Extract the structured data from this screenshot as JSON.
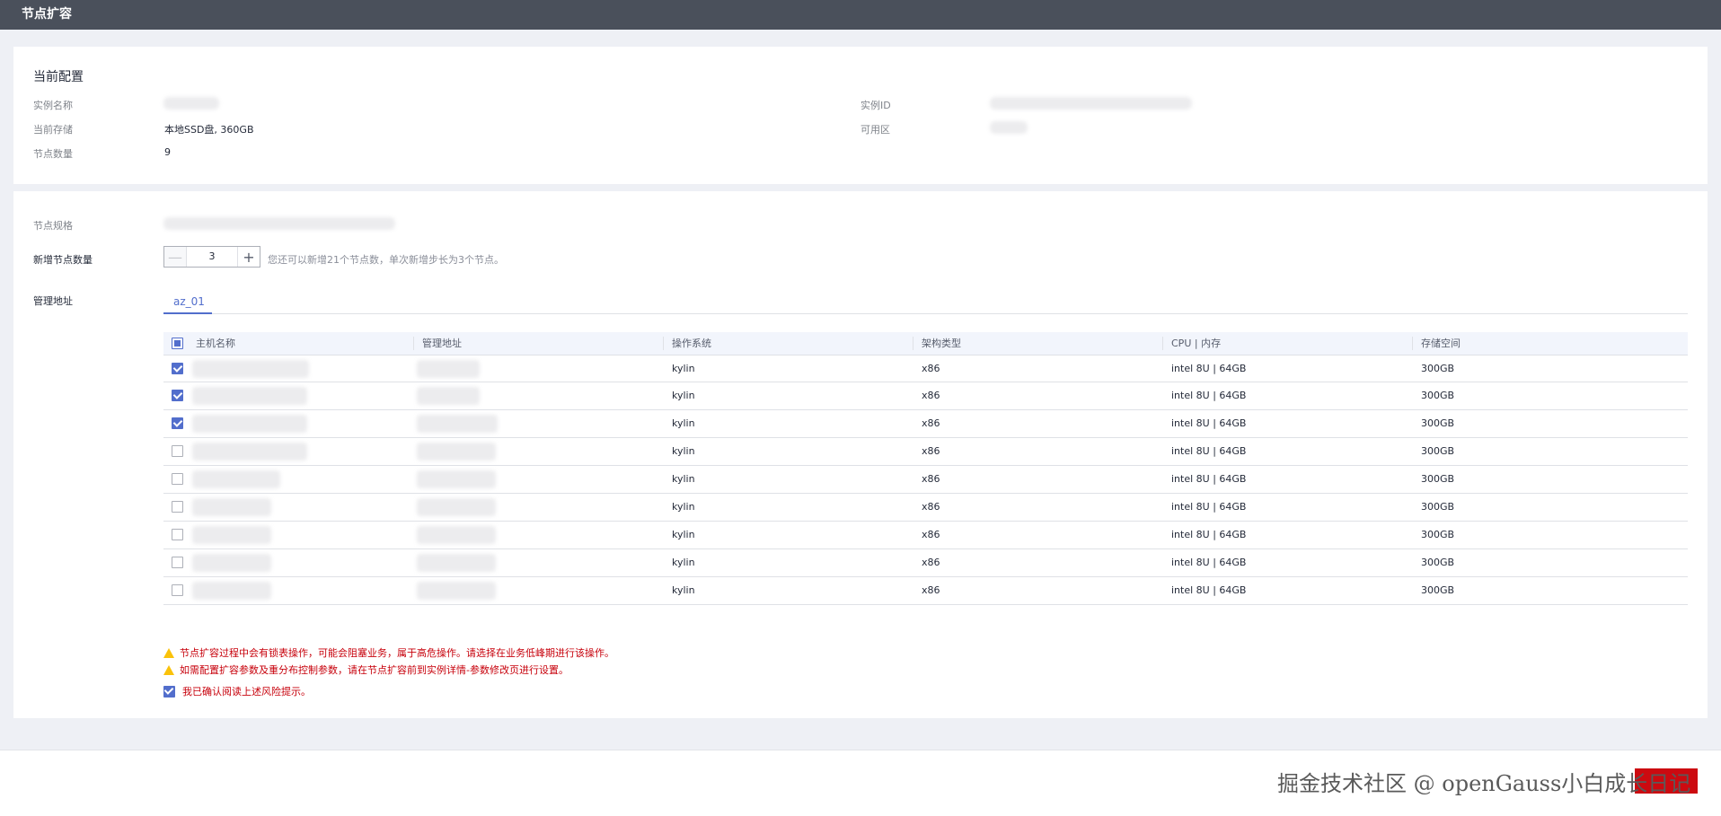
{
  "window": {
    "title": "节点扩容"
  },
  "current_config": {
    "section_title": "当前配置",
    "instance_name_label": "实例名称",
    "instance_id_label": "实例ID",
    "storage_label": "当前存储",
    "storage_value": "本地SSD盘, 360GB",
    "az_label": "可用区",
    "node_count_label": "节点数量",
    "node_count_value": "9"
  },
  "form": {
    "spec_label": "节点规格",
    "add_count_label": "新增节点数量",
    "add_count_value": "3",
    "add_count_hint": "您还可以新增21个节点数，单次新增步长为3个节点。",
    "mgmt_label": "管理地址"
  },
  "tabs": [
    {
      "label": "az_01",
      "active": true
    }
  ],
  "table": {
    "headers": [
      "主机名称",
      "管理地址",
      "操作系统",
      "架构类型",
      "CPU | 内存",
      "存储空间"
    ],
    "header_checkbox": "partial",
    "rows": [
      {
        "checked": true,
        "os": "kylin",
        "arch": "x86",
        "cpu_mem": "intel 8U | 64GB",
        "storage": "300GB"
      },
      {
        "checked": true,
        "os": "kylin",
        "arch": "x86",
        "cpu_mem": "intel 8U | 64GB",
        "storage": "300GB"
      },
      {
        "checked": true,
        "os": "kylin",
        "arch": "x86",
        "cpu_mem": "intel 8U | 64GB",
        "storage": "300GB"
      },
      {
        "checked": false,
        "os": "kylin",
        "arch": "x86",
        "cpu_mem": "intel 8U | 64GB",
        "storage": "300GB"
      },
      {
        "checked": false,
        "os": "kylin",
        "arch": "x86",
        "cpu_mem": "intel 8U | 64GB",
        "storage": "300GB"
      },
      {
        "checked": false,
        "os": "kylin",
        "arch": "x86",
        "cpu_mem": "intel 8U | 64GB",
        "storage": "300GB"
      },
      {
        "checked": false,
        "os": "kylin",
        "arch": "x86",
        "cpu_mem": "intel 8U | 64GB",
        "storage": "300GB"
      },
      {
        "checked": false,
        "os": "kylin",
        "arch": "x86",
        "cpu_mem": "intel 8U | 64GB",
        "storage": "300GB"
      },
      {
        "checked": false,
        "os": "kylin",
        "arch": "x86",
        "cpu_mem": "intel 8U | 64GB",
        "storage": "300GB"
      }
    ]
  },
  "warnings": [
    "节点扩容过程中会有锁表操作，可能会阻塞业务，属于高危操作。请选择在业务低峰期进行该操作。",
    "如需配置扩容参数及重分布控制参数，请在节点扩容前到实例详情-参数修改页进行设置。"
  ],
  "confirm_label": "我已确认阅读上述风险提示。",
  "watermark": "掘金技术社区 @ openGauss小白成长日记",
  "colors": {
    "title_bar": "#4a505b",
    "accent": "#526ecc",
    "warning_text": "#c7000b",
    "warning_icon": "#fac20a"
  }
}
